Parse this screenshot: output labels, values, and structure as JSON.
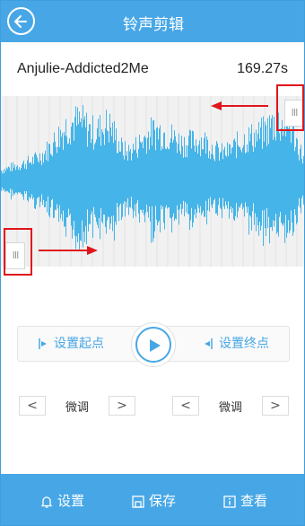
{
  "header": {
    "title": "铃声剪辑",
    "back_icon": "back-arrow-icon"
  },
  "track": {
    "name": "Anjulie-Addicted2Me",
    "duration": "169.27s"
  },
  "waveform": {
    "color": "#45b4e8",
    "background": "#f1f1f1"
  },
  "markers": {
    "end_handle_glyph": "III",
    "start_handle_glyph": "III",
    "annotation_color": "#e0151b"
  },
  "controls": {
    "set_start": "设置起点",
    "set_end": "设置终点",
    "play_icon": "play-icon"
  },
  "fine_tune": {
    "start": {
      "dec": "<",
      "label": "微调",
      "inc": ">"
    },
    "end": {
      "dec": "<",
      "label": "微调",
      "inc": ">"
    }
  },
  "bottom_nav": {
    "settings": "设置",
    "save": "保存",
    "view": "查看"
  },
  "colors": {
    "accent": "#47a7e6",
    "text": "#222222"
  }
}
